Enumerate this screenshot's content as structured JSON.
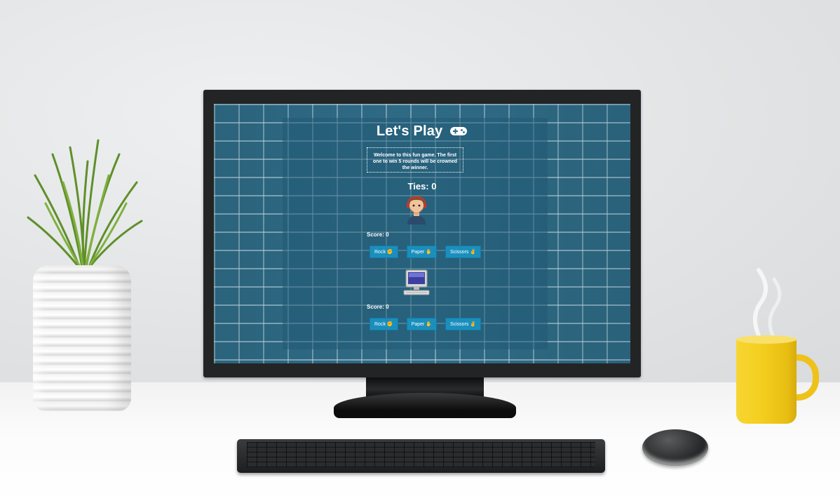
{
  "game": {
    "title": "Let's Play",
    "welcome_text": "Welcome to this fun game. The first one to win 5 rounds will be crowned the winner.",
    "ties_text": "Ties: 0",
    "player": {
      "score_text": "Score: 0",
      "buttons": [
        {
          "label": "Rock ✊"
        },
        {
          "label": "Paper ✋"
        },
        {
          "label": "Scissors ✌"
        }
      ]
    },
    "computer": {
      "score_text": "Score: 0",
      "buttons": [
        {
          "label": "Rock ✊"
        },
        {
          "label": "Paper ✋"
        },
        {
          "label": "Scissors ✌"
        }
      ]
    }
  },
  "icons": {
    "title_icon": "gamepad-icon",
    "player_avatar": "player-avatar-icon",
    "computer_avatar": "computer-avatar-icon"
  },
  "colors": {
    "button_bg": "#1a8fbe",
    "panel_bg": "#205a74",
    "brick_bg": "#2f6a84"
  }
}
